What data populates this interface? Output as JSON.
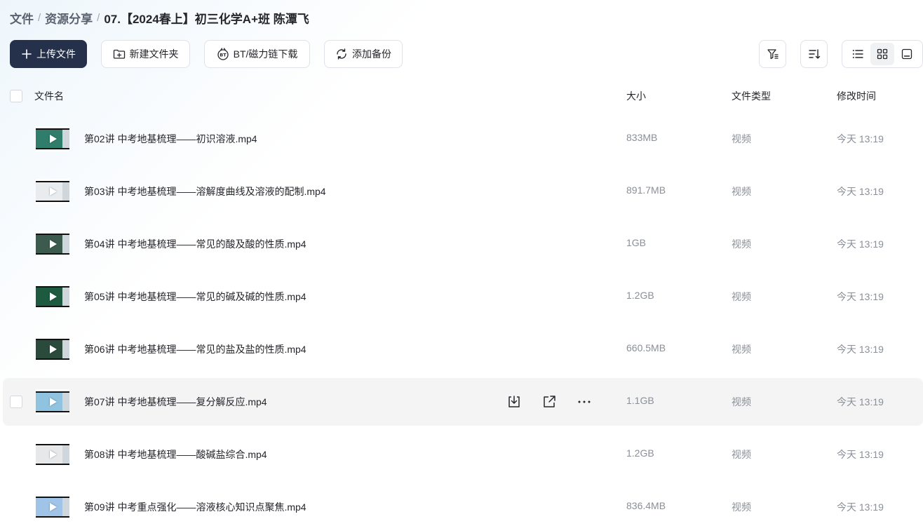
{
  "breadcrumb": {
    "items": [
      "文件",
      "资源分享"
    ],
    "separator": "/",
    "current": "07.【2024春上】初三化学A+班 陈潭飞"
  },
  "toolbar": {
    "upload_label": "上传文件",
    "new_folder_label": "新建文件夹",
    "bt_label": "BT/磁力链下载",
    "backup_label": "添加备份"
  },
  "right_tools": {
    "filter_icon": "filter-icon",
    "sort_icon": "sort-icon",
    "views": [
      "list-view-icon",
      "grid-view-icon",
      "preview-view-icon"
    ],
    "active_view": "list-view-icon"
  },
  "table": {
    "headers": {
      "name": "文件名",
      "size": "大小",
      "type": "文件类型",
      "time": "修改时间"
    },
    "rows": [
      {
        "name": "第02讲 中考地基梳理——初识溶液.mp4",
        "size": "833MB",
        "type": "视频",
        "time": "今天 13:19",
        "thumb_color": "#2f7d6a"
      },
      {
        "name": "第03讲 中考地基梳理——溶解度曲线及溶液的配制.mp4",
        "size": "891.7MB",
        "type": "视频",
        "time": "今天 13:19",
        "thumb_color": "#e9ecef"
      },
      {
        "name": "第04讲 中考地基梳理——常见的酸及酸的性质.mp4",
        "size": "1GB",
        "type": "视频",
        "time": "今天 13:19",
        "thumb_color": "#3c5a4e"
      },
      {
        "name": "第05讲 中考地基梳理——常见的碱及碱的性质.mp4",
        "size": "1.2GB",
        "type": "视频",
        "time": "今天 13:19",
        "thumb_color": "#1d5a3f"
      },
      {
        "name": "第06讲 中考地基梳理——常见的盐及盐的性质.mp4",
        "size": "660.5MB",
        "type": "视频",
        "time": "今天 13:19",
        "thumb_color": "#2a4a3c"
      },
      {
        "name": "第07讲 中考地基梳理——复分解反应.mp4",
        "size": "1.1GB",
        "type": "视频",
        "time": "今天 13:19",
        "thumb_color": "#8fc3e0"
      },
      {
        "name": "第08讲 中考地基梳理——酸碱盐综合.mp4",
        "size": "1.2GB",
        "type": "视频",
        "time": "今天 13:19",
        "thumb_color": "#e6e8ea"
      },
      {
        "name": "第09讲 中考重点强化——溶液核心知识点聚焦.mp4",
        "size": "836.4MB",
        "type": "视频",
        "time": "今天 13:19",
        "thumb_color": "#9fc4e8"
      }
    ],
    "hover_row_index": 5
  },
  "colors": {
    "primary": "#25304a",
    "muted_text": "#8a8f98",
    "hover_bg": "#f4f4f5"
  }
}
